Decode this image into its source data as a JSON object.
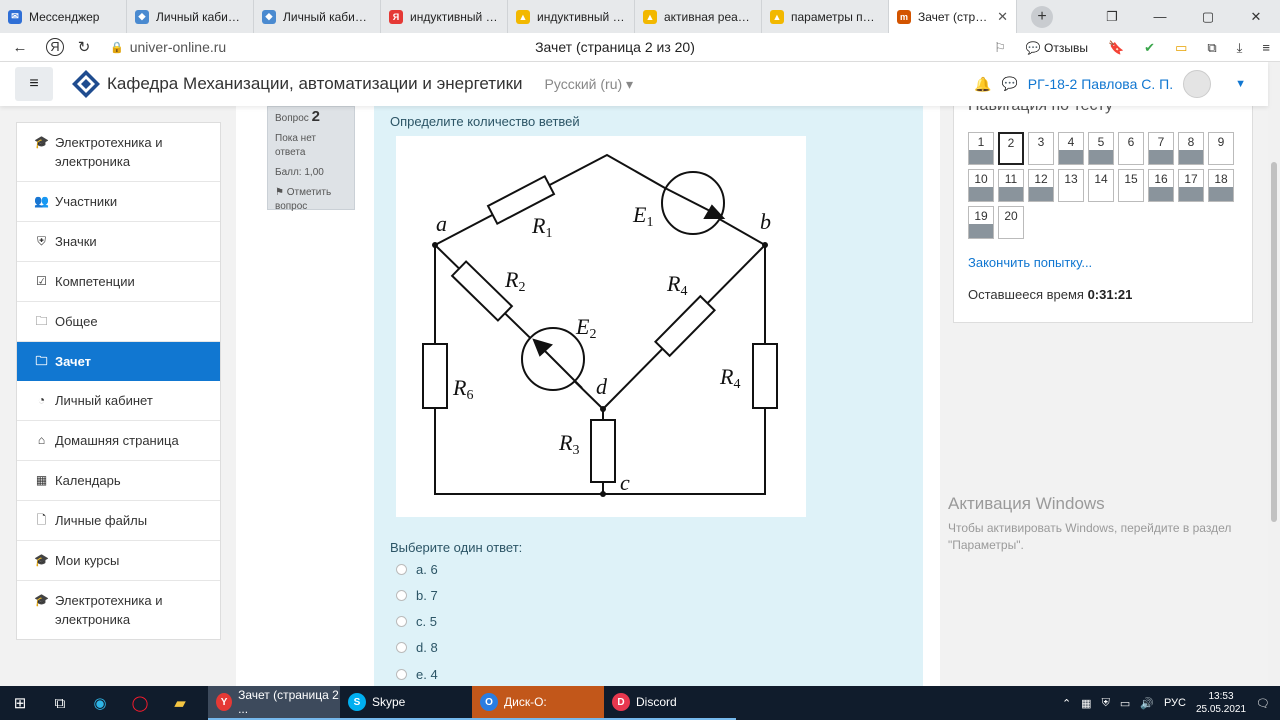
{
  "browser": {
    "tabs": [
      {
        "label": "Мессенджер",
        "color": "#2f6fd6",
        "icon": "messenger-icon"
      },
      {
        "label": "Личный кабинет",
        "color": "#4a8ad0",
        "icon": "site-icon"
      },
      {
        "label": "Личный кабинет",
        "color": "#4a8ad0",
        "icon": "site-icon"
      },
      {
        "label": "индуктивный и ем",
        "color": "#e53935",
        "icon": "yandex-icon"
      },
      {
        "label": "индуктивный и ем",
        "color": "#f2b800",
        "icon": "image-icon"
      },
      {
        "label": "активная реактив",
        "color": "#f2b800",
        "icon": "image-icon"
      },
      {
        "label": "параметры перем",
        "color": "#f2b800",
        "icon": "image-icon"
      },
      {
        "label": "Зачет (страниц",
        "color": "#d35400",
        "icon": "moodle-icon"
      }
    ],
    "domain": "univer-online.ru",
    "page_title": "Зачет (страница 2 из 20)",
    "feedback": "Отзывы"
  },
  "header": {
    "menu_icon": "≡",
    "site_name": "Кафедра Механизации, автоматизации и энергетики",
    "language": "Русский (ru)",
    "user": "РГ-18-2 Павлова С. П."
  },
  "sidebar": {
    "group1": [
      {
        "label": "Электротехника и электроника",
        "icon": "graduation-cap-icon"
      },
      {
        "label": "Участники",
        "icon": "users-icon"
      },
      {
        "label": "Значки",
        "icon": "shield-icon"
      },
      {
        "label": "Компетенции",
        "icon": "checkbox-icon"
      },
      {
        "label": "Общее",
        "icon": "folder-icon"
      },
      {
        "label": "Зачет",
        "icon": "folder-icon",
        "active": true
      }
    ],
    "group2": [
      {
        "label": "Личный кабинет",
        "icon": "dashboard-icon"
      },
      {
        "label": "Домашняя страница",
        "icon": "home-icon"
      },
      {
        "label": "Календарь",
        "icon": "calendar-icon"
      },
      {
        "label": "Личные файлы",
        "icon": "file-icon"
      },
      {
        "label": "Мои курсы",
        "icon": "graduation-cap-icon"
      },
      {
        "label": "Электротехника и электроника",
        "icon": "graduation-cap-icon"
      }
    ]
  },
  "question": {
    "number_label": "Вопрос",
    "number": "2",
    "status": "Пока нет ответа",
    "score": "Балл: 1,00",
    "flag": "Отметить вопрос",
    "text": "Определите количество ветвей",
    "prompt": "Выберите один ответ:",
    "answers": [
      "a. 6",
      "b. 7",
      "c. 5",
      "d. 8",
      "e. 4"
    ],
    "diagram_labels": {
      "a": "a",
      "b": "b",
      "c": "c",
      "d": "d",
      "R1": "R",
      "R2": "R",
      "R3": "R",
      "R4": "R",
      "R6": "R",
      "E1": "E",
      "E2": "E",
      "sub1": "1",
      "sub2": "2",
      "sub3": "3",
      "sub4": "4",
      "sub6": "6"
    }
  },
  "quiz_nav": {
    "title": "Навигация по тесту",
    "buttons": [
      {
        "n": "1",
        "answered": true
      },
      {
        "n": "2",
        "answered": false,
        "current": true
      },
      {
        "n": "3",
        "answered": false
      },
      {
        "n": "4",
        "answered": true
      },
      {
        "n": "5",
        "answered": true
      },
      {
        "n": "6",
        "answered": false
      },
      {
        "n": "7",
        "answered": true
      },
      {
        "n": "8",
        "answered": true
      },
      {
        "n": "9",
        "answered": false
      },
      {
        "n": "10",
        "answered": true
      },
      {
        "n": "11",
        "answered": true
      },
      {
        "n": "12",
        "answered": true
      },
      {
        "n": "13",
        "answered": false
      },
      {
        "n": "14",
        "answered": false
      },
      {
        "n": "15",
        "answered": false
      },
      {
        "n": "16",
        "answered": true
      },
      {
        "n": "17",
        "answered": true
      },
      {
        "n": "18",
        "answered": true
      },
      {
        "n": "19",
        "answered": true
      },
      {
        "n": "20",
        "answered": false
      }
    ],
    "finish": "Закончить попытку...",
    "time_label": "Оставшееся время",
    "time": "0:31:21"
  },
  "watermark": {
    "title": "Активация Windows",
    "text": "Чтобы активировать Windows, перейдите в раздел \"Параметры\"."
  },
  "taskbar": {
    "apps": [
      {
        "label": "Зачет (страница 2 ...",
        "icon": "yandex-browser-icon",
        "color": "#e53935",
        "active": true
      },
      {
        "label": "Skype",
        "icon": "skype-icon",
        "color": "#00aff0"
      },
      {
        "label": "Диск-О:",
        "icon": "disk-o-icon",
        "color": "#2a7de1"
      },
      {
        "label": "Discord",
        "icon": "discord-icon",
        "color": "#e8384f"
      }
    ],
    "lang": "РУС",
    "time": "13:53",
    "date": "25.05.2021"
  }
}
